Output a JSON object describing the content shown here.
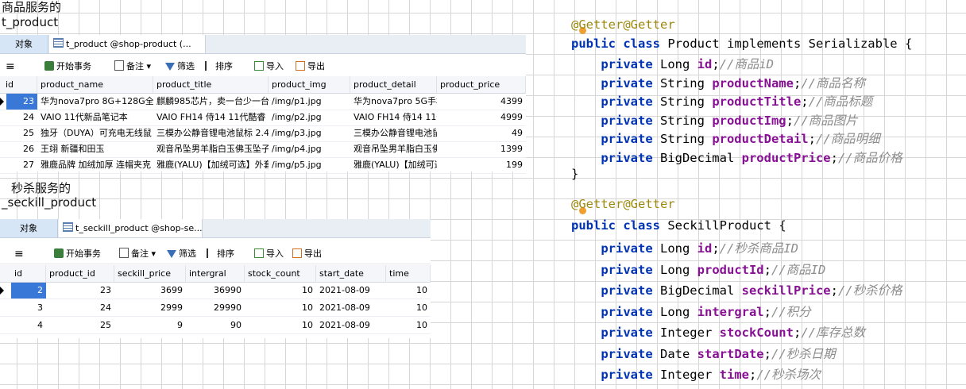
{
  "left": {
    "label1": "商品服务的",
    "label2": "t_product",
    "label3": "秒杀服务的",
    "label4": "_seckill_product"
  },
  "panel1": {
    "tab_object": "对象",
    "tab_table": "t_product @shop-product (...",
    "toolbar": {
      "menu": "≡",
      "begin_tx": "开始事务",
      "note": "备注",
      "filter": "筛选",
      "sort": "排序",
      "import": "导入",
      "export": "导出"
    },
    "columns": [
      "id",
      "product_name",
      "product_title",
      "product_img",
      "product_detail",
      "product_price"
    ],
    "rows": [
      [
        "23",
        "华为nova7pro 8G+128G全",
        "麒麟985芯片，卖一台少一台",
        "/img/p1.jpg",
        "华为nova7pro 5G手机",
        "4399"
      ],
      [
        "24",
        "VAIO 11代新品笔记本",
        "VAIO FH14 侍14 11代酷睿",
        "/img/p2.jpg",
        "VAIO FH14 侍14 11代",
        "4999"
      ],
      [
        "25",
        "独牙（DUYA）可充电无线鼠",
        "三模办公静音锂电池鼠标 2.4",
        "/img/p3.jpg",
        "三模办公静音锂电池鼠",
        "49"
      ],
      [
        "26",
        "王翊 新疆和田玉",
        "观音吊坠男羊脂白玉佛玉坠子",
        "/img/p4.jpg",
        "观音吊坠男羊脂白玉佛",
        "1399"
      ],
      [
        "27",
        "雅鹿品牌 加绒加厚 连帽夹克",
        "雅鹿(YALU)【加绒可选】外套",
        "/img/p5.jpg",
        "雅鹿(YALU)【加绒可选",
        "199"
      ]
    ]
  },
  "panel2": {
    "tab_object": "对象",
    "tab_table": "t_seckill_product @shop-se...",
    "toolbar": {
      "menu": "≡",
      "begin_tx": "开始事务",
      "note": "备注",
      "filter": "筛选",
      "sort": "排序",
      "import": "导入",
      "export": "导出"
    },
    "columns": [
      "id",
      "product_id",
      "seckill_price",
      "intergral",
      "stock_count",
      "start_date",
      "time"
    ],
    "rows": [
      [
        "2",
        "23",
        "3699",
        "36990",
        "10",
        "2021-08-09",
        "10"
      ],
      [
        "3",
        "24",
        "2999",
        "29990",
        "10",
        "2021-08-09",
        "10"
      ],
      [
        "4",
        "25",
        "9",
        "90",
        "10",
        "2021-08-09",
        "10"
      ]
    ]
  },
  "code1": {
    "annotation": "@Getter@Getter",
    "decl": [
      "public class ",
      "Product",
      " implements Serializable {"
    ],
    "fields": [
      {
        "mod": "private ",
        "type": "Long ",
        "name": "id",
        "comment": "//商品iD"
      },
      {
        "mod": "private ",
        "type": "String ",
        "name": "productName",
        "comment": "//商品名称"
      },
      {
        "mod": "private ",
        "type": "String ",
        "name": "productTitle",
        "comment": "//商品标题"
      },
      {
        "mod": "private ",
        "type": "String ",
        "name": "productImg",
        "comment": "//商品图片"
      },
      {
        "mod": "private ",
        "type": "String ",
        "name": "productDetail",
        "comment": "//商品明细"
      },
      {
        "mod": "private ",
        "type": "BigDecimal ",
        "name": "productPrice",
        "comment": "//商品价格"
      }
    ],
    "close": "}"
  },
  "code2": {
    "annotation": "@Getter@Getter",
    "decl": [
      "public class ",
      "SeckillProduct",
      " {"
    ],
    "fields": [
      {
        "mod": "private ",
        "type": "Long ",
        "name": "id",
        "comment": "//秒杀商品ID"
      },
      {
        "mod": "private ",
        "type": "Long ",
        "name": "productId",
        "comment": "//商品ID"
      },
      {
        "mod": "private ",
        "type": "BigDecimal ",
        "name": "seckillPrice",
        "comment": "//秒杀价格"
      },
      {
        "mod": "private ",
        "type": "Long ",
        "name": "intergral",
        "comment": "//积分"
      },
      {
        "mod": "private ",
        "type": "Integer ",
        "name": "stockCount",
        "comment": "//库存总数"
      },
      {
        "mod": "private ",
        "type": "Date ",
        "name": "startDate",
        "comment": "//秒杀日期"
      },
      {
        "mod": "private ",
        "type": "Integer ",
        "name": "time",
        "comment": "//秒杀场次"
      }
    ]
  }
}
